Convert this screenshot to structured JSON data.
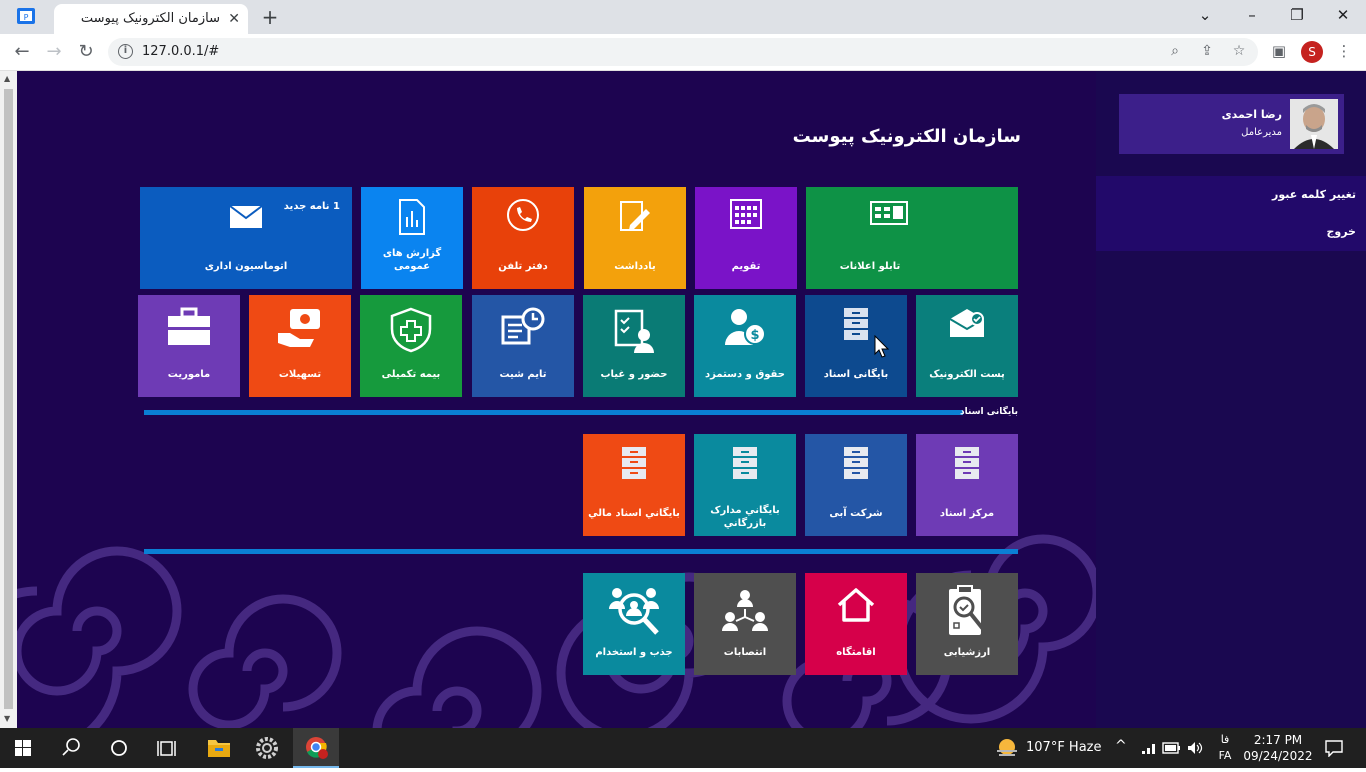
{
  "browser": {
    "tab_title": "سازمان الکترونیک پیوست",
    "url": "127.0.0.1/#",
    "profile_initial": "S"
  },
  "page": {
    "title": "سازمان الکترونیک پیوست",
    "user": {
      "name": "رضا احمدی",
      "role": "مدیرعامل"
    },
    "menu": [
      "تغییر کلمه عبور",
      "خروج"
    ],
    "main_tiles": [
      {
        "label": "اتوماسیون اداری",
        "badge": "1 نامه جدید",
        "color": "#0b5cbf",
        "icon": "envelope-icon"
      },
      {
        "label": "گزارش های عمومی",
        "color": "#0a84f0",
        "icon": "report-icon"
      },
      {
        "label": "دفتر تلفن",
        "color": "#e8410a",
        "icon": "phone-icon"
      },
      {
        "label": "یادداشت",
        "color": "#f3a10c",
        "icon": "note-icon"
      },
      {
        "label": "تقویم",
        "color": "#7a13c8",
        "icon": "calendar-icon"
      },
      {
        "label": "تابلو اعلانات",
        "color": "#0e9246",
        "icon": "noticeboard-icon"
      },
      {
        "label": "ماموریت",
        "color": "#6e3bb5",
        "icon": "briefcase-icon"
      },
      {
        "label": "تسهیلات",
        "color": "#ef4a14",
        "icon": "loan-icon"
      },
      {
        "label": "بیمه تکمیلی",
        "color": "#169a3d",
        "icon": "insurance-icon"
      },
      {
        "label": "تایم شیت",
        "color": "#2456a6",
        "icon": "timesheet-icon"
      },
      {
        "label": "حضور و غیاب",
        "color": "#0a7b75",
        "icon": "attendance-icon"
      },
      {
        "label": "حقوق و دستمزد",
        "color": "#0a8a9e",
        "icon": "salary-icon"
      },
      {
        "label": "بایگانی اسناد",
        "color": "#0d4a8f",
        "icon": "archive-icon"
      },
      {
        "label": "پست الکترونیک",
        "color": "#0a7f7c",
        "icon": "email-icon"
      }
    ],
    "archive_section_label": "بایگانی اسناد",
    "archive_tiles": [
      {
        "label": "بايگاني اسناد مالي",
        "color": "#ef4a14",
        "icon": "cabinet-icon"
      },
      {
        "label": "بايگاني مدارک بازرگاني",
        "color": "#0a8a9e",
        "icon": "cabinet-icon"
      },
      {
        "label": "شرکت آبی",
        "color": "#2456a6",
        "icon": "cabinet-icon"
      },
      {
        "label": "مرکز اسناد",
        "color": "#6e3bb5",
        "icon": "cabinet-icon"
      }
    ],
    "hr_tiles": [
      {
        "label": "جذب و استخدام",
        "color": "#0a8a9e",
        "icon": "recruit-icon"
      },
      {
        "label": "انتصابات",
        "color": "#4f4f4f",
        "icon": "org-icon"
      },
      {
        "label": "اقامتگاه",
        "color": "#d6004a",
        "icon": "home-icon"
      },
      {
        "label": "ارزشیابی",
        "color": "#4f4f4f",
        "icon": "evaluation-icon"
      }
    ]
  },
  "taskbar": {
    "weather": "107°F  Haze",
    "lang_top": "فا",
    "lang_bottom": "FA",
    "time": "2:17 PM",
    "date": "09/24/2022"
  }
}
